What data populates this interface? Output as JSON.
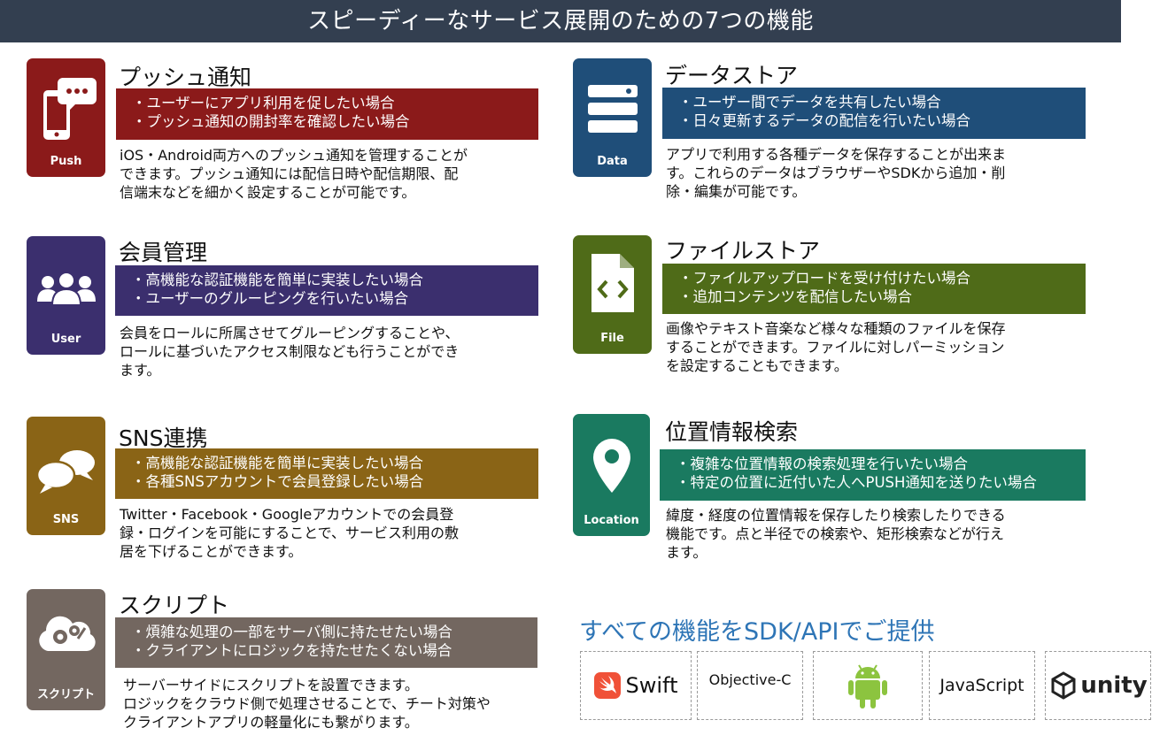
{
  "header": {
    "title": "スピーディーなサービス展開のための7つの機能"
  },
  "features": {
    "push": {
      "tile_label": "Push",
      "icon": "phone-chat-icon",
      "color": "#8b1a1a",
      "title": "プッシュ通知",
      "bullets": [
        "・ユーザーにアプリ利用を促したい場合",
        "・プッシュ通知の開封率を確認したい場合"
      ],
      "desc": [
        "iOS・Android両方へのプッシュ通知を管理することが",
        "できます。プッシュ通知には配信日時や配信期限、配",
        "信端末などを細かく設定することが可能です。"
      ]
    },
    "data": {
      "tile_label": "Data",
      "icon": "database-icon",
      "color": "#1f4e79",
      "title": "データストア",
      "bullets": [
        "・ユーザー間でデータを共有したい場合",
        "・日々更新するデータの配信を行いたい場合"
      ],
      "desc": [
        "アプリで利用する各種データを保存することが出来ま",
        "す。これらのデータはブラウザーやSDKから追加・削",
        "除・編集が可能です。"
      ]
    },
    "user": {
      "tile_label": "User",
      "icon": "users-icon",
      "color": "#3b2f6e",
      "title": "会員管理",
      "bullets": [
        "・高機能な認証機能を簡単に実装したい場合",
        "・ユーザーのグルーピングを行いたい場合"
      ],
      "desc": [
        "会員をロールに所属させてグルーピングすることや、",
        "ロールに基づいたアクセス制限なども行うことができ",
        "ます。"
      ]
    },
    "file": {
      "tile_label": "File",
      "icon": "code-file-icon",
      "color": "#4f6b18",
      "title": "ファイルストア",
      "bullets": [
        "・ファイルアップロードを受け付けたい場合",
        "・追加コンテンツを配信したい場合"
      ],
      "desc": [
        "画像やテキスト音楽など様々な種類のファイルを保存",
        "することができます。ファイルに対しパーミッション",
        "を設定することもできます。"
      ]
    },
    "sns": {
      "tile_label": "SNS",
      "icon": "speech-bubbles-icon",
      "color": "#8a6416",
      "title": "SNS連携",
      "bullets": [
        "・高機能な認証機能を簡単に実装したい場合",
        "・各種SNSアカウントで会員登録したい場合"
      ],
      "desc": [
        "Twitter・Facebook・Googleアカウントでの会員登",
        "録・ログインを可能にすることで、サービス利用の敷",
        "居を下げることができます。"
      ]
    },
    "location": {
      "tile_label": "Location",
      "icon": "map-pin-icon",
      "color": "#1a7a60",
      "title": "位置情報検索",
      "bullets": [
        "・複雑な位置情報の検索処理を行いたい場合",
        "・特定の位置に近付いた人へPUSH通知を送りたい場合"
      ],
      "desc": [
        "緯度・経度の位置情報を保存したり検索したりできる",
        "機能です。点と半径での検索や、矩形検索などが行え",
        "ます。"
      ]
    },
    "script": {
      "tile_label": "スクリプト",
      "icon": "cloud-gears-icon",
      "color": "#736760",
      "title": "スクリプト",
      "bullets": [
        "・煩雑な処理の一部をサーバ側に持たせたい場合",
        "・クライアントにロジックを持たせたくない場合"
      ],
      "desc": [
        "サーバーサイドにスクリプトを設置できます。",
        "ロジックをクラウド側で処理させることで、チート対策や",
        "クライアントアプリの軽量化にも繋がります。"
      ]
    }
  },
  "sdk": {
    "title": "すべての機能をSDK/APIでご提供",
    "items": [
      {
        "label": "Swift",
        "icon": "swift-logo-icon",
        "color": "#f05138"
      },
      {
        "label": "Objective-C",
        "icon": ""
      },
      {
        "label": "",
        "icon": "android-logo-icon",
        "color": "#8cc43f"
      },
      {
        "label": "JavaScript",
        "icon": ""
      },
      {
        "label": "unity",
        "icon": "unity-logo-icon",
        "color": "#222222"
      }
    ]
  }
}
